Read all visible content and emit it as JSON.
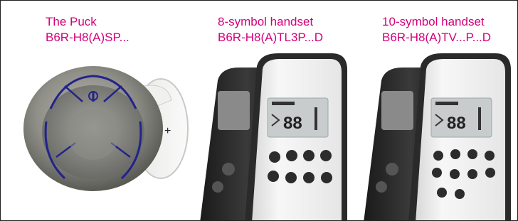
{
  "colors": {
    "caption": "#d4007a",
    "frame": "#1f1f1f"
  },
  "products": [
    {
      "name": "The Puck",
      "code": "B6R-H8(A)SP...",
      "icon": "puck-remote-icon",
      "side_button_symbol": "+"
    },
    {
      "name": "8-symbol handset",
      "code": "B6R-H8(A)TL3P...D",
      "icon": "handset-8-symbol-icon",
      "display_digits": "88"
    },
    {
      "name": "10-symbol handset",
      "code": "B6R-H8(A)TV...P...D",
      "icon": "handset-10-symbol-icon",
      "display_digits": "88"
    }
  ]
}
